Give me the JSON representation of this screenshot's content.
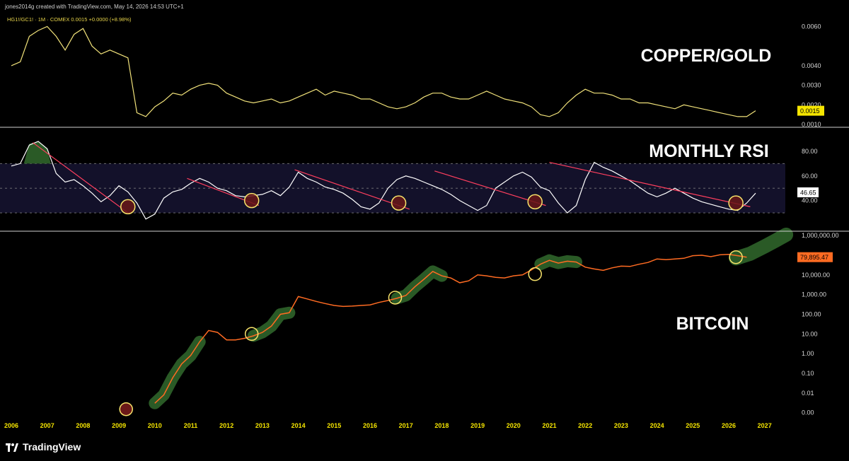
{
  "header": {
    "attribution": "jones2014g created with TradingView.com, May 14, 2026 14:53 UTC+1",
    "legend": "HG1!/GC1! · 1M · COMEX 0.0015 +0.0000 (+8.98%)"
  },
  "footer": {
    "brand": "TradingView",
    "logo_icon": "tradingview-logo-icon"
  },
  "colors": {
    "background": "#000000",
    "copper_gold_line": "#f1e27a",
    "copper_gold_badge": "#f5e500",
    "rsi_line": "#ffffff",
    "rsi_band": "#13112a",
    "trendline": "#ff3f5e",
    "bitcoin_line": "#ff6b22",
    "bitcoin_badge": "#ff6b22",
    "green_highlight": "#2a5a26",
    "circle_stroke": "#f7e36a",
    "circle_fill": "#6a1818",
    "axis_text": "#d8d8d8",
    "year_text": "#f5e500"
  },
  "chart_data": [
    {
      "name": "copper_gold",
      "type": "line",
      "annotation": "COPPER/GOLD",
      "x_start": 2006.0,
      "x_step": 0.25,
      "ylim": [
        0.001,
        0.0062
      ],
      "yticks": [
        "0.0060",
        "0.0040",
        "0.0030",
        "0.0020",
        "0.0010"
      ],
      "last_value_label": "0.0015",
      "values": [
        0.004,
        0.0042,
        0.0055,
        0.0058,
        0.006,
        0.0055,
        0.0048,
        0.0056,
        0.0059,
        0.005,
        0.0046,
        0.0048,
        0.0046,
        0.0044,
        0.0016,
        0.0014,
        0.0019,
        0.0022,
        0.0026,
        0.0025,
        0.0028,
        0.003,
        0.0031,
        0.003,
        0.0026,
        0.0024,
        0.0022,
        0.0021,
        0.0022,
        0.0023,
        0.0021,
        0.0022,
        0.0024,
        0.0026,
        0.0028,
        0.0025,
        0.0027,
        0.0026,
        0.0025,
        0.0023,
        0.0023,
        0.0021,
        0.0019,
        0.0018,
        0.0019,
        0.0021,
        0.0024,
        0.0026,
        0.0026,
        0.0024,
        0.0023,
        0.0023,
        0.0025,
        0.0027,
        0.0025,
        0.0023,
        0.0022,
        0.0021,
        0.0019,
        0.0015,
        0.0014,
        0.0016,
        0.0021,
        0.0025,
        0.0028,
        0.0026,
        0.0026,
        0.0025,
        0.0023,
        0.0023,
        0.0021,
        0.0021,
        0.002,
        0.0019,
        0.0018,
        0.002,
        0.0019,
        0.0018,
        0.0017,
        0.0016,
        0.0015,
        0.0014,
        0.0014,
        0.0017
      ]
    },
    {
      "name": "monthly_rsi",
      "type": "line",
      "annotation": "MONTHLY RSI",
      "x_start": 2006.0,
      "x_step": 0.25,
      "ylim": [
        18,
        96
      ],
      "yticks": [
        "80.00",
        "60.00",
        "40.00"
      ],
      "band": [
        30,
        70
      ],
      "midline": 50,
      "last_value_label": "46.65",
      "values": [
        68,
        70,
        85,
        88,
        82,
        62,
        55,
        57,
        52,
        46,
        39,
        44,
        52,
        47,
        38,
        25,
        29,
        42,
        47,
        49,
        54,
        58,
        55,
        50,
        48,
        44,
        43,
        44,
        45,
        48,
        44,
        51,
        63,
        58,
        55,
        51,
        49,
        46,
        41,
        35,
        33,
        38,
        50,
        57,
        60,
        58,
        55,
        52,
        49,
        45,
        40,
        36,
        32,
        36,
        50,
        55,
        60,
        63,
        59,
        51,
        48,
        38,
        30,
        36,
        57,
        71,
        67,
        64,
        60,
        56,
        51,
        46,
        43,
        46,
        50,
        46,
        42,
        39,
        37,
        35,
        33,
        32,
        38,
        46
      ],
      "trendlines": [
        {
          "x": [
            2006.6,
            2009.3
          ],
          "y": [
            87,
            29
          ]
        },
        {
          "x": [
            2010.9,
            2012.9
          ],
          "y": [
            58,
            36
          ]
        },
        {
          "x": [
            2013.9,
            2017.1
          ],
          "y": [
            65,
            33
          ]
        },
        {
          "x": [
            2017.8,
            2020.9
          ],
          "y": [
            64,
            36
          ]
        },
        {
          "x": [
            2021.0,
            2026.6
          ],
          "y": [
            71,
            35
          ]
        }
      ],
      "circles": [
        {
          "x": 2009.25,
          "y": 35
        },
        {
          "x": 2012.7,
          "y": 40
        },
        {
          "x": 2016.8,
          "y": 38
        },
        {
          "x": 2020.6,
          "y": 39
        },
        {
          "x": 2026.2,
          "y": 38
        }
      ]
    },
    {
      "name": "bitcoin",
      "type": "line",
      "annotation": "BITCOIN",
      "scale": "log",
      "x_start": 2010.0,
      "x_step": 0.25,
      "ylim": [
        0.0005,
        1300000
      ],
      "yticks": [
        "1,000,000.00",
        "10,000.00",
        "1,000.00",
        "100.00",
        "10.00",
        "1.00",
        "0.10",
        "0.01",
        "0.00"
      ],
      "tick_values": [
        1000000,
        10000,
        1000,
        100,
        10,
        1,
        0.1,
        0.01,
        0.001
      ],
      "last_value_label": "79,895.47",
      "values": [
        0.003,
        0.008,
        0.06,
        0.3,
        0.8,
        4,
        15,
        12,
        5,
        5,
        6,
        8,
        12,
        25,
        100,
        120,
        800,
        600,
        450,
        350,
        280,
        250,
        260,
        280,
        300,
        400,
        500,
        650,
        900,
        2500,
        6000,
        15000,
        9000,
        7000,
        4000,
        5000,
        10000,
        9000,
        7500,
        7000,
        9000,
        10000,
        18000,
        35000,
        55000,
        40000,
        50000,
        45000,
        25000,
        20000,
        17000,
        23000,
        28000,
        27000,
        35000,
        43000,
        65000,
        60000,
        65000,
        70000,
        95000,
        100000,
        85000,
        105000,
        110000,
        95000,
        80000
      ],
      "green_segments": [
        [
          2009.8,
          2011.45
        ],
        [
          2012.7,
          2013.9
        ],
        [
          2016.6,
          2018.0
        ],
        [
          2020.6,
          2021.8
        ],
        [
          2026.2,
          2027.6
        ]
      ],
      "green_projection": [
        [
          2026.2,
          70000
        ],
        [
          2026.6,
          120000
        ],
        [
          2027.0,
          280000
        ],
        [
          2027.3,
          550000
        ],
        [
          2027.6,
          1100000
        ]
      ],
      "circles": [
        {
          "x": 2009.2,
          "y": 0.0015,
          "style": "red"
        },
        {
          "x": 2012.7,
          "y": 10,
          "style": "yellow"
        },
        {
          "x": 2016.7,
          "y": 700,
          "style": "yellow"
        },
        {
          "x": 2020.6,
          "y": 11000,
          "style": "yellow"
        },
        {
          "x": 2026.2,
          "y": 80000,
          "style": "yellow"
        }
      ]
    }
  ],
  "x_axis": {
    "years": [
      "2006",
      "2007",
      "2008",
      "2009",
      "2010",
      "2011",
      "2012",
      "2013",
      "2014",
      "2015",
      "2016",
      "2017",
      "2018",
      "2019",
      "2020",
      "2021",
      "2022",
      "2023",
      "2024",
      "2025",
      "2026",
      "2027"
    ]
  }
}
